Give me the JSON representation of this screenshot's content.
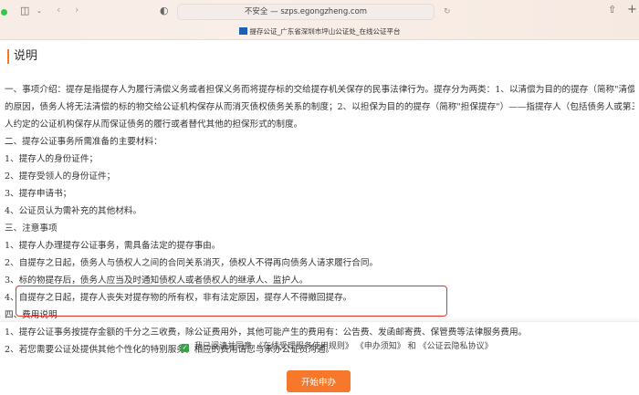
{
  "browser": {
    "url": "不安全 — szps.egongzheng.com",
    "tab_title": "提存公证_广东省深圳市坪山公证处_在线公证平台"
  },
  "section_title": "说明",
  "lines": [
    "一、事项介绍：提存是指提存人为履行清偿义务或者担保义务而将提存标的交给提存机关保存的民事法律行为。提存分为两类：1、以清偿为目的的提存（简称\"清偿提存\"）——指由于债权人",
    "的原因，债务人将无法清偿的标的物交给公证机构保存从而消灭债权债务关系的制度；2、以担保为目的的提存（简称\"担保提存\"）——指提存人（包括债务人或第三人）将标的物交给与债权",
    "人约定的公证机构保存从而保证债务的履行或者替代其他的担保形式的制度。",
    "二、提存公证事务所需准备的主要材料：",
    "1、提存人的身份证件；",
    "2、提存受领人的身份证件；",
    "3、提存申请书；",
    "4、公证员认为需补充的其他材料。",
    "三、注意事项",
    "1、提存人办理提存公证事务，需具备法定的提存事由。",
    "2、自提存之日起，债务人与债权人之间的合同关系消灭，债权人不得再向债务人请求履行合同。",
    "3、标的物提存后，债务人应当及时通知债权人或者债权人的继承人、监护人。",
    "4、自提存之日起，提存人丧失对提存物的所有权，非有法定原因，提存人不得撤回提存。",
    "四、费用说明",
    "1、提存公证事务按提存金额的千分之三收费，除公证费用外，其他可能产生的费用有：公告费、发函邮寄费、保管费等法律服务费用。",
    "2、若您需要公证处提供其他个性化的特别服务，相应的费用请您与承办公证员沟通。"
  ],
  "agreement": {
    "text": "我已阅读并同意",
    "rules": "《在线受理服务使用规则》",
    "notice": "《申办须知》",
    "and": "和",
    "privacy": "《公证云隐私协议》",
    "checked": true
  },
  "start_button": "开始申办",
  "colors": {
    "accent": "#f7782a",
    "highlight": "#e8322a",
    "check": "#3aa34a"
  }
}
